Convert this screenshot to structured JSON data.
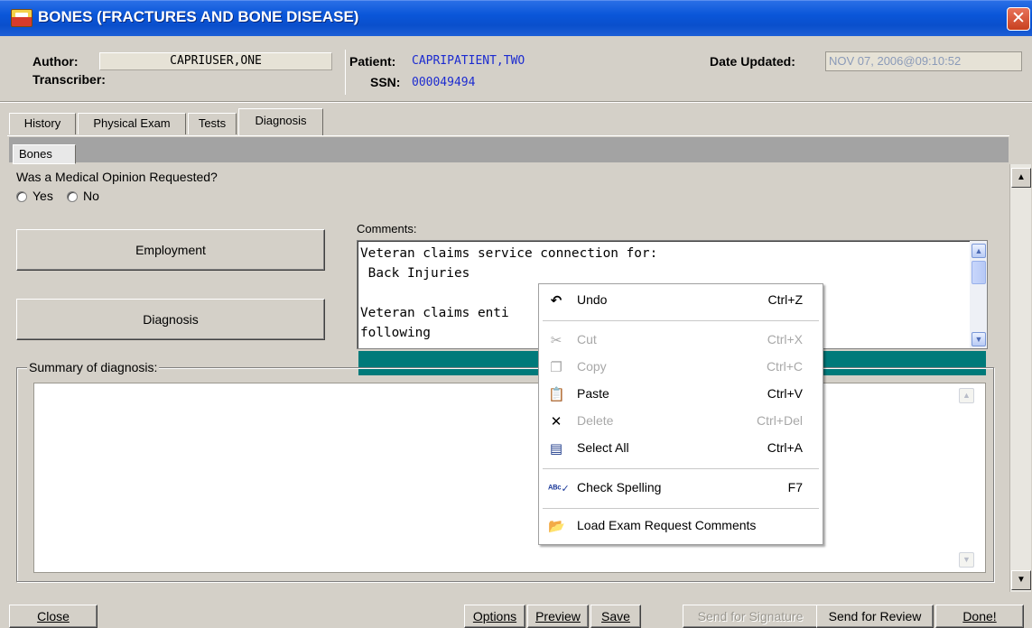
{
  "window": {
    "title": "BONES (FRACTURES AND BONE DISEASE)"
  },
  "header": {
    "author_label": "Author:",
    "author_value": "CAPRIUSER,ONE",
    "transcriber_label": "Transcriber:",
    "patient_label": "Patient:",
    "patient_value": "CAPRIPATIENT,TWO",
    "ssn_label": "SSN:",
    "ssn_value": "000049494",
    "date_label": "Date Updated:",
    "date_value": "NOV 07, 2006@09:10:52"
  },
  "tabs": [
    "History",
    "Physical Exam",
    "Tests",
    "Diagnosis"
  ],
  "active_tab": "Diagnosis",
  "subtabs": [
    "Bones"
  ],
  "opinion": {
    "question": "Was a Medical Opinion Requested?",
    "yes": "Yes",
    "no": "No"
  },
  "side_buttons": {
    "employment": "Employment",
    "diagnosis": "Diagnosis"
  },
  "comments": {
    "label": "Comments:",
    "text": "Veteran claims service connection for:\n Back Injuries\n\nVeteran claims enti                        ased on the\nfollowing"
  },
  "summary": {
    "label": "Summary of diagnosis:"
  },
  "context_menu": {
    "items": [
      {
        "label": "Undo",
        "shortcut": "Ctrl+Z",
        "icon": "undo-icon",
        "enabled": true
      },
      {
        "label": "Cut",
        "shortcut": "Ctrl+X",
        "icon": "scissors-icon",
        "enabled": false
      },
      {
        "label": "Copy",
        "shortcut": "Ctrl+C",
        "icon": "copy-icon",
        "enabled": false
      },
      {
        "label": "Paste",
        "shortcut": "Ctrl+V",
        "icon": "paste-icon",
        "enabled": true
      },
      {
        "label": "Delete",
        "shortcut": "Ctrl+Del",
        "icon": "delete-x-icon",
        "enabled": false
      },
      {
        "label": "Select All",
        "shortcut": "Ctrl+A",
        "icon": "select-all-icon",
        "enabled": true
      },
      {
        "label": "Check Spelling",
        "shortcut": "F7",
        "icon": "spellcheck-icon",
        "enabled": true
      },
      {
        "label": "Load Exam Request Comments",
        "shortcut": "",
        "icon": "open-folder-icon",
        "enabled": true
      }
    ]
  },
  "footer": {
    "close": "Close",
    "options": "Options",
    "preview": "Preview",
    "save": "Save",
    "send_signature": "Send for Signature",
    "send_review": "Send for Review",
    "done": "Done!"
  },
  "colors": {
    "titlebar": "#0a56d9",
    "teal_bar": "#007a7a",
    "patient_text": "#1c2bd0"
  }
}
